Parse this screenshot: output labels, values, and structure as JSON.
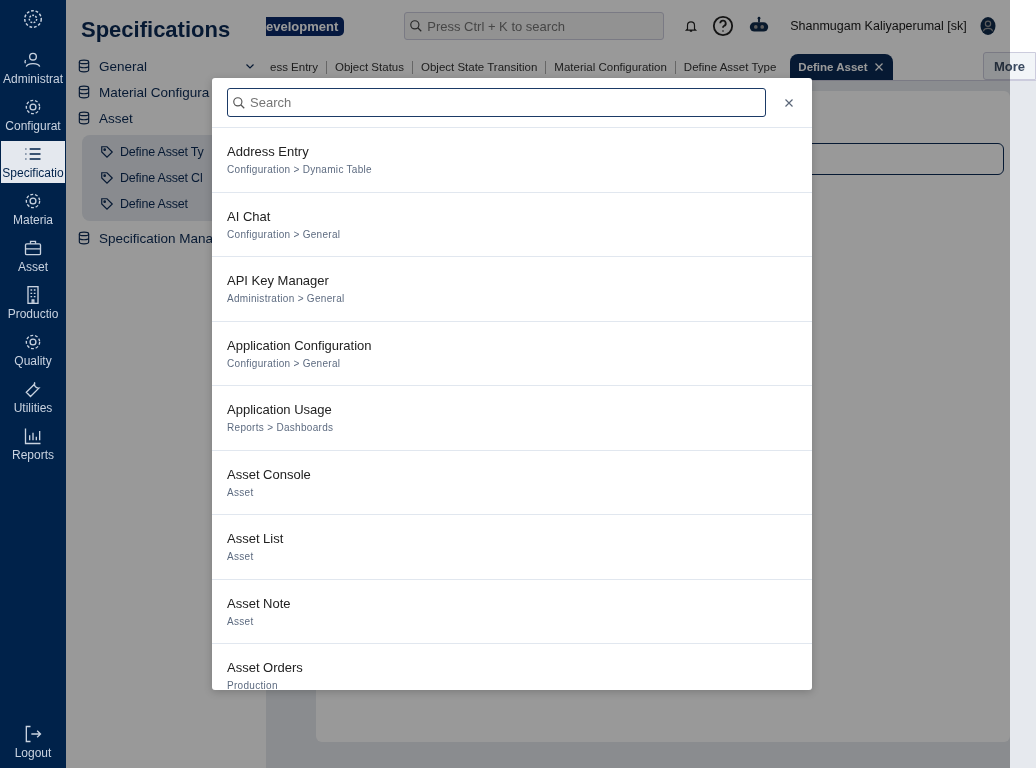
{
  "rail": {
    "items": [
      {
        "label": "Administrat",
        "selected": false
      },
      {
        "label": "Configurat",
        "selected": false
      },
      {
        "label": "Specificatio",
        "selected": true
      },
      {
        "label": "Materia",
        "selected": false
      },
      {
        "label": "Asset",
        "selected": false
      },
      {
        "label": "Productio",
        "selected": false
      },
      {
        "label": "Quality",
        "selected": false
      },
      {
        "label": "Utilities",
        "selected": false
      },
      {
        "label": "Reports",
        "selected": false
      }
    ],
    "logout": "Logout"
  },
  "sidebar": {
    "title": "Specifications",
    "items": [
      {
        "label": "General",
        "chevron": true
      },
      {
        "label": "Material Configura"
      },
      {
        "label": "Asset",
        "children": [
          {
            "label": "Define Asset Ty"
          },
          {
            "label": "Define Asset Cl"
          },
          {
            "label": "Define Asset"
          }
        ]
      },
      {
        "label": "Specification Mana"
      }
    ]
  },
  "header": {
    "badge": "evelopment",
    "search": {
      "placeholder": "Press Ctrl + K to search"
    },
    "user": "Shanmugam Kaliyaperumal [sk]"
  },
  "tabs": [
    {
      "label": "ess Entry",
      "selected": false
    },
    {
      "label": "Object Status",
      "selected": false
    },
    {
      "label": "Object State Transition",
      "selected": false
    },
    {
      "label": "Material Configuration",
      "selected": false
    },
    {
      "label": "Define Asset Type",
      "selected": false
    },
    {
      "label": "Define Asset",
      "selected": true
    }
  ],
  "more": "More",
  "dialog": {
    "search": {
      "placeholder": "Search"
    },
    "results": [
      {
        "title": "Address Entry",
        "path": "Configuration > Dynamic Table"
      },
      {
        "title": "AI Chat",
        "path": "Configuration > General"
      },
      {
        "title": "API Key Manager",
        "path": "Administration > General"
      },
      {
        "title": "Application Configuration",
        "path": "Configuration > General"
      },
      {
        "title": "Application Usage",
        "path": "Reports > Dashboards"
      },
      {
        "title": "Asset Console",
        "path": "Asset"
      },
      {
        "title": "Asset List",
        "path": "Asset"
      },
      {
        "title": "Asset Note",
        "path": "Asset"
      },
      {
        "title": "Asset Orders",
        "path": "Production"
      }
    ]
  }
}
